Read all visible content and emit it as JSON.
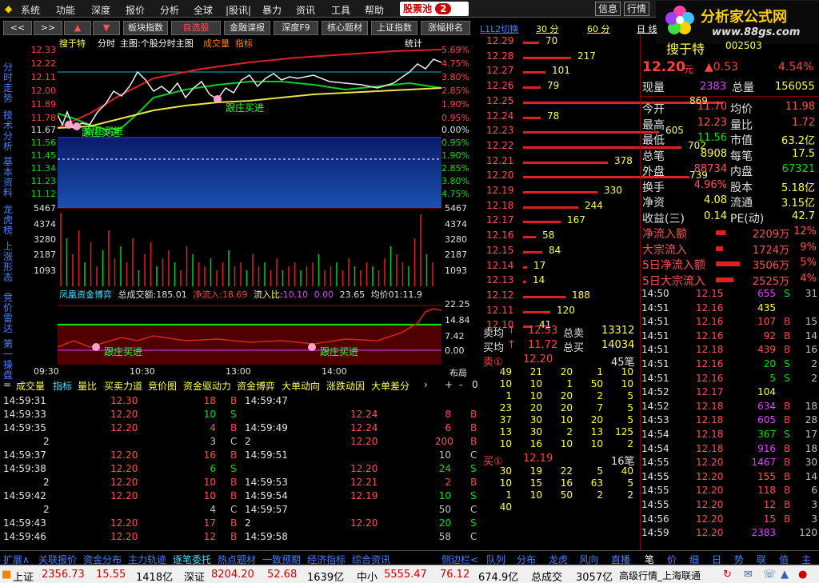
{
  "menu": {
    "items": [
      "系统",
      "功能",
      "深度",
      "报价",
      "分析",
      "全球",
      "|股讯|",
      "暴力",
      "资讯",
      "工具",
      "帮助"
    ],
    "pool": "股票池",
    "pool_count": "2",
    "info": "信息",
    "quote": "行情"
  },
  "logo": {
    "title": "分析家公式网",
    "url": "www.88gs.com"
  },
  "toolbar": {
    "back": "<<",
    "fwd": ">>",
    "up": "▲",
    "down": "▼",
    "buttons": [
      "板块指数",
      "自选股",
      "金融谍报",
      "深度F9",
      "核心题材",
      "上证指数",
      "涨幅排名"
    ],
    "l2": "L1L2切换",
    "tab30": "30 分",
    "tab60": "60 分",
    "tabday": "日 线"
  },
  "side": [
    "分时走势",
    "技术分析",
    "基本资料",
    "龙虎榜",
    "上涨形态",
    "竞价雷达",
    "第一操盘"
  ],
  "chart": {
    "title": "搜于特",
    "sub1": "分时",
    "sub2": "主图:个股分时主图",
    "sub3": "成交量",
    "sub4": "指标",
    "stat": "统计",
    "price_ticks": [
      "12.33",
      "12.22",
      "12.11",
      "12.00",
      "11.89",
      "11.78",
      "11.67",
      "11.56",
      "11.45",
      "11.34",
      "11.23",
      "11.12"
    ],
    "pct_ticks": [
      "5.69%",
      "4.75%",
      "3.80%",
      "2.85%",
      "1.90%",
      "0.95%",
      "0.00%",
      "0.95%",
      "1.90%",
      "2.85%",
      "3.80%",
      "4.75%"
    ],
    "vol_ticks": [
      "5467",
      "4374",
      "3280",
      "2187",
      "1093"
    ],
    "annot1": "跟庄买进",
    "annot2": "跟庄买进",
    "annot3": "跟庄买进",
    "annot4": "跟庄买进"
  },
  "fund": {
    "label": "凤凰资金博弈",
    "total_label": "总成交额:",
    "total": "185.01",
    "inflow_label": "净流入:",
    "inflow": "18.69",
    "ratio_label": "流入比:",
    "ratio": "10.10",
    "v1": "0.00",
    "v2": "23.65",
    "avg_label": "均价01:11.9",
    "ticks": [
      "22.25",
      "14.84",
      "7.42",
      "0.00"
    ]
  },
  "time_axis": [
    "09:30",
    "10:30",
    "13:00",
    "14:00"
  ],
  "layout_label": "布局",
  "tabs": [
    "成交量",
    "指标",
    "量比",
    "买卖力道",
    "竞价图",
    "资金驱动力",
    "资金博弈",
    "大单动向",
    "涨跌动因",
    "大单差分"
  ],
  "tab_nav": [
    "+",
    "-",
    "0"
  ],
  "ticks_left": [
    [
      "14:59:31",
      "12.30",
      "18",
      "B",
      "14:59:47",
      "",
      "",
      ""
    ],
    [
      "14:59:33",
      "12.20",
      "10",
      "S",
      "",
      "12.24",
      "8",
      "B"
    ],
    [
      "14:59:35",
      "12.20",
      "4",
      "B",
      "14:59:49",
      "12.24",
      "6",
      "B"
    ],
    [
      "2",
      "",
      "3",
      "C",
      "2",
      "12.20",
      "200",
      "B"
    ],
    [
      "14:59:37",
      "12.20",
      "16",
      "B",
      "14:59:51",
      "",
      "10",
      "C"
    ],
    [
      "14:59:38",
      "12.20",
      "6",
      "S",
      "",
      "12.20",
      "24",
      "S"
    ],
    [
      "2",
      "12.20",
      "10",
      "B",
      "14:59:53",
      "12.21",
      "2",
      "B"
    ],
    [
      "14:59:42",
      "12.20",
      "10",
      "B",
      "14:59:54",
      "12.19",
      "10",
      "S"
    ],
    [
      "2",
      "",
      "4",
      "C",
      "14:59:57",
      "",
      "50",
      "C"
    ],
    [
      "14:59:43",
      "12.20",
      "17",
      "B",
      "2",
      "12.20",
      "20",
      "S"
    ],
    [
      "14:59:46",
      "12.20",
      "12",
      "B",
      "14:59:58",
      "",
      "58",
      "C"
    ]
  ],
  "ladder": [
    [
      "12.29",
      "70",
      20
    ],
    [
      "12.28",
      "217",
      60
    ],
    [
      "12.27",
      "101",
      28
    ],
    [
      "12.26",
      "79",
      22
    ],
    [
      "12.25",
      "869",
      250
    ],
    [
      "12.24",
      "78",
      22
    ],
    [
      "12.23",
      "605",
      170
    ],
    [
      "12.22",
      "702",
      198
    ],
    [
      "12.21",
      "378",
      106
    ],
    [
      "12.20",
      "739",
      208
    ],
    [
      "12.19",
      "330",
      93
    ],
    [
      "12.18",
      "244",
      69
    ],
    [
      "12.17",
      "167",
      47
    ],
    [
      "12.16",
      "58",
      16
    ],
    [
      "12.15",
      "84",
      24
    ],
    [
      "12.14",
      "17",
      5
    ],
    [
      "12.13",
      "14",
      4
    ],
    [
      "12.12",
      "188",
      53
    ],
    [
      "12.11",
      "120",
      34
    ],
    [
      "12.10",
      "41",
      12
    ]
  ],
  "book": {
    "sell_avg_l": "卖均",
    "sell_avg": "12.53",
    "total_sell_l": "总卖",
    "total_sell": "13312",
    "buy_avg_l": "买均",
    "buy_avg": "11.72",
    "total_buy_l": "总买",
    "total_buy": "14034",
    "ask1_l": "卖①",
    "ask1": "12.20",
    "ask1_n": "45笔",
    "bid1_l": "买①",
    "bid1": "12.19",
    "bid1_n": "16笔",
    "ask_rows": [
      [
        "49",
        "21",
        "20",
        "1",
        "10"
      ],
      [
        "10",
        "10",
        "1",
        "50",
        "10"
      ],
      [
        "1",
        "10",
        "20",
        "2",
        "5"
      ],
      [
        "23",
        "20",
        "20",
        "7",
        "5"
      ],
      [
        "37",
        "30",
        "10",
        "20",
        "5"
      ],
      [
        "13",
        "30",
        "2",
        "13",
        "125"
      ],
      [
        "10",
        "16",
        "10",
        "10",
        "2"
      ]
    ],
    "bid_rows": [
      [
        "30",
        "19",
        "22",
        "5",
        "40"
      ],
      [
        "10",
        "15",
        "16",
        "63",
        "5"
      ],
      [
        "1",
        "10",
        "50",
        "2",
        "2"
      ],
      [
        "40",
        "",
        "",
        "",
        ""
      ]
    ]
  },
  "quote": {
    "name": "搜于特",
    "code": "002503",
    "price": "12.20",
    "unit": "元",
    "chg": "▲0.53",
    "pct": "4.54%",
    "now_vol_l": "现量",
    "now_vol": "2383",
    "total_vol_l": "总量",
    "total_vol": "156055",
    "rows": [
      [
        "今开",
        "11.70",
        "均价",
        "11.98"
      ],
      [
        "最高",
        "12.23",
        "量比",
        "1.72"
      ],
      [
        "最低",
        "11.56",
        "市值",
        "63.2亿"
      ],
      [
        "总笔",
        "8908",
        "每笔",
        "17.5"
      ],
      [
        "外盘",
        "88734",
        "内盘",
        "67321"
      ],
      [
        "换手",
        "4.96%",
        "股本",
        "5.18亿"
      ],
      [
        "净资",
        "4.08",
        "流通",
        "3.15亿"
      ],
      [
        "收益(三)",
        "0.14",
        "PE(动)",
        "42.7"
      ]
    ],
    "flows": [
      [
        "净流入额",
        "2209万",
        "12%",
        12
      ],
      [
        "大宗流入",
        "1724万",
        "9%",
        9
      ],
      [
        "5日净流入额",
        "3506万",
        "5%",
        30
      ],
      [
        "5日大宗流入",
        "2525万",
        "4%",
        22
      ]
    ]
  },
  "ticks_right": [
    [
      "14:50",
      "12.15",
      "655",
      "S",
      "31"
    ],
    [
      "14:51",
      "12.16",
      "435",
      "",
      ""
    ],
    [
      "14:51",
      "12.16",
      "107",
      "B",
      "15"
    ],
    [
      "14:51",
      "12.16",
      "92",
      "B",
      "14"
    ],
    [
      "14:51",
      "12.18",
      "439",
      "B",
      "16"
    ],
    [
      "14:51",
      "12.16",
      "20",
      "S",
      "2"
    ],
    [
      "14:51",
      "12.16",
      "5",
      "S",
      "2"
    ],
    [
      "14:52",
      "12.17",
      "104",
      "",
      ""
    ],
    [
      "14:52",
      "12.18",
      "634",
      "B",
      "18"
    ],
    [
      "14:53",
      "12.18",
      "605",
      "B",
      "28"
    ],
    [
      "14:54",
      "12.18",
      "367",
      "S",
      "17"
    ],
    [
      "14:54",
      "12.18",
      "916",
      "B",
      "18"
    ],
    [
      "14:55",
      "12.20",
      "1467",
      "B",
      "30"
    ],
    [
      "14:55",
      "12.20",
      "155",
      "B",
      "14"
    ],
    [
      "14:55",
      "12.20",
      "118",
      "B",
      "6"
    ],
    [
      "14:55",
      "12.20",
      "12",
      "B",
      "3"
    ],
    [
      "14:56",
      "12.20",
      "15",
      "B",
      "3"
    ],
    [
      "14:59",
      "12.20",
      "2383",
      "",
      "120"
    ]
  ],
  "bottom": {
    "left": [
      "扩展∧",
      "关联报价",
      "资金分布",
      "主力轨迹",
      "逐笔委托",
      "热点题材",
      "一致预期",
      "经济指标",
      "综合资讯"
    ],
    "side": "侧边栏<",
    "mid": [
      "队列",
      "分布",
      "龙虎",
      "风向",
      "直播"
    ],
    "right": [
      "笔",
      "价",
      "细",
      "日",
      "势",
      "联",
      "值",
      "主"
    ]
  },
  "status": {
    "sh_l": "上证",
    "sh": "2356.73",
    "sh_c": "15.55",
    "sh_v": "1418亿",
    "sz_l": "深证",
    "sz": "8204.20",
    "sz_c": "52.68",
    "sz_v": "1639亿",
    "zx_l": "中小",
    "zx": "5555.47",
    "zx_c": "76.12",
    "zx_v": "674.9亿",
    "tot_l": "总成交",
    "tot": "3057亿",
    "feed": "高级行情_上海联通"
  }
}
